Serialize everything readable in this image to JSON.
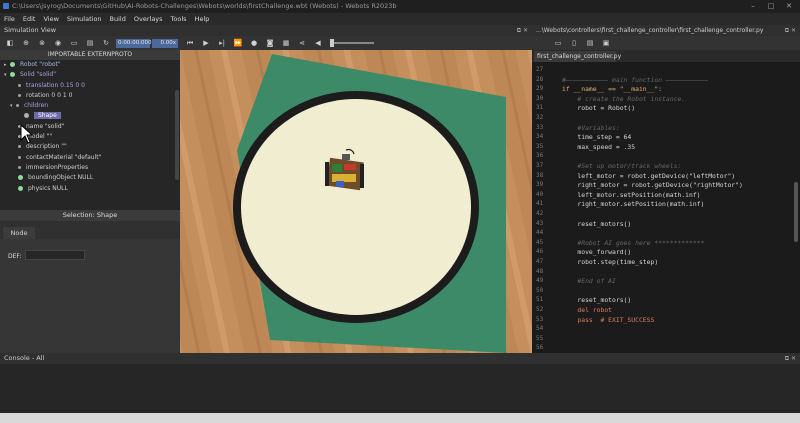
{
  "window": {
    "title": "C:\\Users\\jsyrog\\Documents\\GitHub\\AI-Robots-Challenges\\Webots\\worlds\\firstChallenge.wbt (Webots) - Webots R2023b",
    "controls": [
      "–",
      "□",
      "✕"
    ]
  },
  "menu": [
    "File",
    "Edit",
    "View",
    "Simulation",
    "Build",
    "Overlays",
    "Tools",
    "Help"
  ],
  "sim_view": {
    "title": "Simulation View",
    "time": "0:00:00:000",
    "speed": "0.00x"
  },
  "scene_tree": {
    "header": "IMPORTABLE EXTERNPROTO",
    "rows": [
      {
        "text": "Robot \"robot\""
      },
      {
        "text": "Solid \"solid\""
      },
      {
        "text": "translation 0.15 0 0"
      },
      {
        "text": "rotation 0 0 1 0"
      },
      {
        "text": "children"
      },
      {
        "text": "Shape"
      },
      {
        "text": "name \"solid\""
      },
      {
        "text": "model \"\""
      },
      {
        "text": "description \"\""
      },
      {
        "text": "contactMaterial \"default\""
      },
      {
        "text": "immersionProperties"
      },
      {
        "text": "boundingObject NULL"
      },
      {
        "text": "physics NULL"
      }
    ]
  },
  "selection": {
    "title": "Selection: Shape",
    "tab": "Node",
    "def_label": "DEF:",
    "def_value": ""
  },
  "editor": {
    "path": "...\\Webots\\controllers\\first_challenge_controller\\first_challenge_controller.py",
    "tab": "first_challenge_controller.py",
    "lines": [
      {
        "n": "27",
        "t": ""
      },
      {
        "n": "28",
        "t": "#——————————— main function ———————————",
        "c": "cm"
      },
      {
        "n": "29",
        "t": "if __name__ == \"__main__\":",
        "c": "main"
      },
      {
        "n": "30",
        "t": "    # create the Robot instance.",
        "c": "cm"
      },
      {
        "n": "31",
        "t": "    robot = Robot()"
      },
      {
        "n": "32",
        "t": ""
      },
      {
        "n": "33",
        "t": "    #Variables:",
        "c": "cm"
      },
      {
        "n": "34",
        "t": "    time_step = 64"
      },
      {
        "n": "35",
        "t": "    max_speed = .35"
      },
      {
        "n": "36",
        "t": ""
      },
      {
        "n": "37",
        "t": "    #Set up motor/track wheels:",
        "c": "cm"
      },
      {
        "n": "38",
        "t": "    left_motor = robot.getDevice(\"leftMotor\")"
      },
      {
        "n": "39",
        "t": "    right_motor = robot.getDevice(\"rightMotor\")"
      },
      {
        "n": "40",
        "t": "    left_motor.setPosition(math.inf)"
      },
      {
        "n": "41",
        "t": "    right_motor.setPosition(math.inf)"
      },
      {
        "n": "42",
        "t": ""
      },
      {
        "n": "43",
        "t": "    reset_motors()"
      },
      {
        "n": "44",
        "t": ""
      },
      {
        "n": "45",
        "t": "    #Robot AI goes here *************",
        "c": "cm"
      },
      {
        "n": "46",
        "t": "    move_forward()"
      },
      {
        "n": "47",
        "t": "    robot.step(time_step)"
      },
      {
        "n": "48",
        "t": ""
      },
      {
        "n": "49",
        "t": "    #End of AI",
        "c": "cm"
      },
      {
        "n": "50",
        "t": ""
      },
      {
        "n": "51",
        "t": "    reset_motors()"
      },
      {
        "n": "52",
        "t": "    del robot",
        "c": "del"
      },
      {
        "n": "53",
        "t": "    pass  # EXIT_SUCCESS",
        "c": "pass"
      },
      {
        "n": "54",
        "t": ""
      },
      {
        "n": "55",
        "t": ""
      },
      {
        "n": "56",
        "t": ""
      },
      {
        "n": "57",
        "t": ""
      }
    ]
  },
  "console": {
    "title": "Console - All"
  },
  "colors": {
    "floor": "#c89563",
    "mat": "#3d8a68",
    "arena": "#f1edd0",
    "ring": "#1c1c1c",
    "selection": "#6f69a8"
  },
  "icons": [
    "app-icon",
    "tree-toggle-icon",
    "reset-icon",
    "eye-icon",
    "open-icon",
    "save-icon",
    "reload-icon",
    "step-back-icon",
    "play-icon",
    "step-icon",
    "fast-forward-icon",
    "record-icon",
    "screenshot-icon",
    "share-icon",
    "volume-icon"
  ]
}
